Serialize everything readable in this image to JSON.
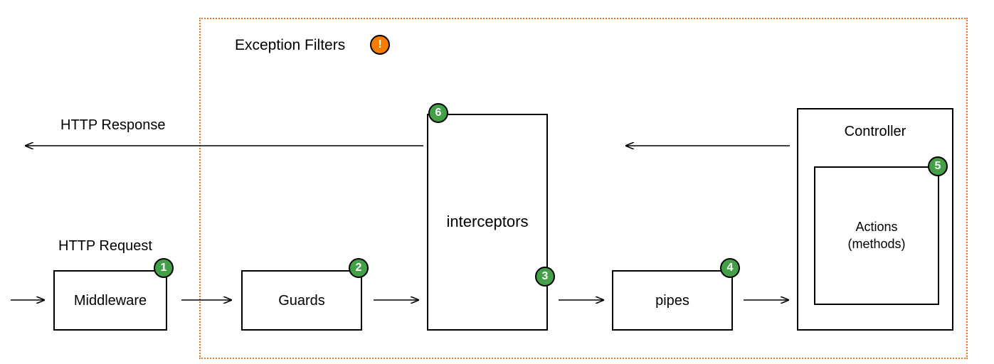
{
  "labels": {
    "exception_filters": "Exception Filters",
    "http_response": "HTTP Response",
    "http_request": "HTTP Request"
  },
  "boxes": {
    "middleware": "Middleware",
    "guards": "Guards",
    "interceptors": "interceptors",
    "pipes": "pipes",
    "controller": "Controller",
    "actions": "Actions\n(methods)"
  },
  "badges": {
    "b1": "1",
    "b2": "2",
    "b3": "3",
    "b4": "4",
    "b5": "5",
    "b6": "6",
    "exc": "!"
  },
  "colors": {
    "dotted": "#e8742a",
    "badge_green": "#43a047",
    "badge_orange": "#f57c00"
  }
}
